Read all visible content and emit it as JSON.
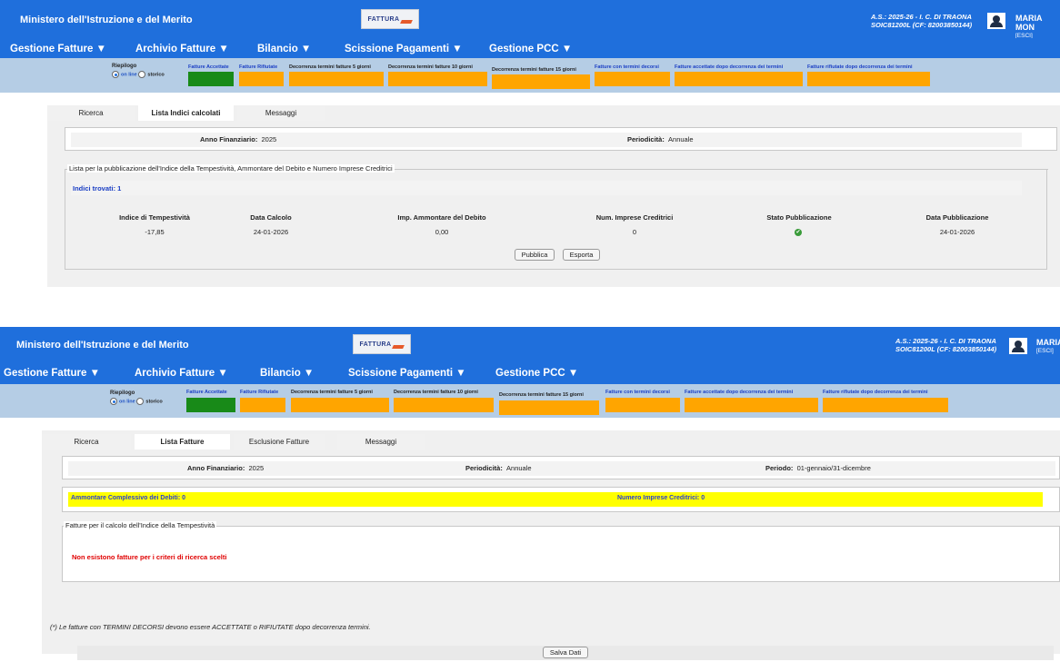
{
  "app_title": "Ministero dell'Istruzione e del Merito",
  "logo_text": "FATTURA",
  "user": {
    "line1": "A.S.: 2025-26 - I. C. DI TRAONA",
    "line2": "SOIC81200L (CF: 82003850144)",
    "name_top": "MARIA MON",
    "name_bottom": "MARIA",
    "exit": "[ESCI]"
  },
  "menu": [
    "Gestione Fatture ▼",
    "Archivio Fatture ▼",
    "Bilancio ▼",
    "Scissione Pagamenti ▼",
    "Gestione PCC ▼"
  ],
  "riepilogo": {
    "label": "Riepilogo",
    "on_line": "on line",
    "storico": "storico"
  },
  "status_labels": [
    "Fatture Accettate",
    "Fatture Rifiutate",
    "Decorrenza termini fatture 5 giorni",
    "Decorrenza termini fatture 10 giorni",
    "Decorrenza termini fatture 15 giorni",
    "Fatture con termini decorsi",
    "Fatture accettate dopo decorrenza dei termini",
    "Fatture rifiutate dopo decorrenza dei termini"
  ],
  "colors": {
    "accent": "#1f6fdc",
    "strip": "#b5cde5",
    "green": "#188a18",
    "orange": "#ffa500",
    "yellow": "#ffff00"
  },
  "top": {
    "tabs": [
      "Ricerca",
      "Lista Indici calcolati",
      "Messaggi"
    ],
    "anno_label": "Anno Finanziario:",
    "anno": "2025",
    "period_label": "Periodicità:",
    "period": "Annuale",
    "fieldset": "Lista per la pubblicazione dell'Indice della Tempestività, Ammontare del Debito e Numero Imprese Creditrici",
    "found": "Indici trovati: 1",
    "headers": [
      "Indice di Tempestività",
      "Data Calcolo",
      "Imp. Ammontare del Debito",
      "Num. Imprese Creditrici",
      "Stato Pubblicazione",
      "Data Pubblicazione"
    ],
    "row": [
      "-17,85",
      "24-01-2026",
      "0,00",
      "0",
      "",
      "24-01-2026"
    ],
    "btn_pubblica": "Pubblica",
    "btn_esporta": "Esporta"
  },
  "bottom": {
    "tabs": [
      "Ricerca",
      "Lista Fatture",
      "Esclusione Fatture",
      "Messaggi"
    ],
    "anno_label": "Anno Finanziario:",
    "anno": "2025",
    "period_label": "Periodicità:",
    "period": "Annuale",
    "periodo_label": "Periodo:",
    "periodo": "01-gennaio/31-dicembre",
    "ammontare": "Ammontare Complessivo dei Debiti: 0",
    "numero": "Numero Imprese Creditrici: 0",
    "fieldset": "Fatture per il calcolo dell'Indice della Tempestività",
    "empty": "Non esistono fatture per i criteri di ricerca scelti",
    "note": "(*) Le fatture con TERMINI DECORSI devono essere ACCETTATE o RIFIUTATE dopo decorrenza termini.",
    "btn_salva": "Salva Dati"
  }
}
